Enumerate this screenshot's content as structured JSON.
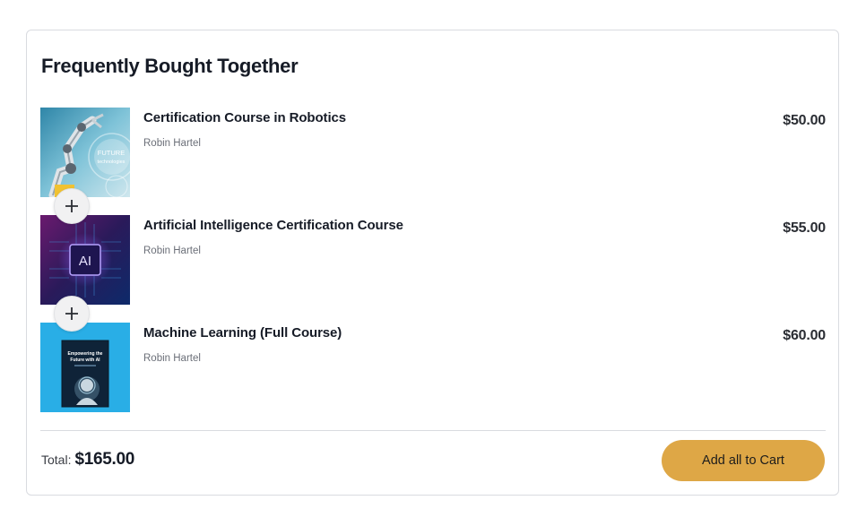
{
  "bundle": {
    "title": "Frequently Bought Together",
    "items": [
      {
        "name": "Certification Course in Robotics",
        "author": "Robin Hartel",
        "price": "$50.00",
        "thumb_icon": "robot-arm-thumbnail",
        "thumb_text": [
          "FUTURE",
          "technologies"
        ]
      },
      {
        "name": "Artificial Intelligence Certification Course",
        "author": "Robin Hartel",
        "price": "$55.00",
        "thumb_icon": "ai-chip-thumbnail",
        "thumb_text": [
          "AI"
        ]
      },
      {
        "name": "Machine Learning (Full Course)",
        "author": "Robin Hartel",
        "price": "$60.00",
        "thumb_icon": "book-cover-thumbnail",
        "thumb_text": [
          "Empowering the",
          "Future with AI"
        ]
      }
    ],
    "plus_icon": "plus-icon",
    "total_label": "Total:",
    "total_value": "$165.00",
    "add_button_label": "Add all to Cart"
  },
  "colors": {
    "button_bg": "#dea746",
    "text": "#161b26",
    "border": "#d9dbe0"
  }
}
